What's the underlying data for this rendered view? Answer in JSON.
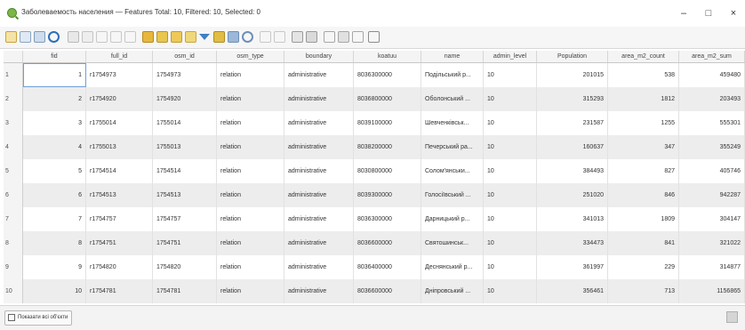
{
  "window": {
    "title": "Заболеваемость населения — Features Total: 10, Filtered: 10, Selected: 0",
    "minimize_glyph": "–",
    "maximize_glyph": "□",
    "close_glyph": "×"
  },
  "toolbar": {
    "icons": [
      "toggle-editing-icon",
      "multi-edit-icon",
      "save-edits-icon",
      "reload-icon",
      "add-feature-icon",
      "delete-feature-icon",
      "cut-icon",
      "copy-icon",
      "paste-icon",
      "select-by-expression-icon",
      "select-all-icon",
      "invert-selection-icon",
      "deselect-all-icon",
      "filter-icon",
      "move-selection-top-icon",
      "pan-to-selected-icon",
      "zoom-to-selected-icon",
      "new-field-icon",
      "delete-field-icon",
      "field-calculator-icon",
      "conditional-formatting-icon",
      "actions-icon",
      "dock-icon"
    ]
  },
  "table": {
    "columns": [
      "fid",
      "full_id",
      "osm_id",
      "osm_type",
      "boundary",
      "koatuu",
      "name",
      "admin_level",
      "Population",
      "area_m2_count",
      "area_m2_sum"
    ],
    "rows": [
      {
        "num": "1",
        "fid": "1",
        "full_id": "r1754973",
        "osm_id": "1754973",
        "osm_type": "relation",
        "boundary": "administrative",
        "koatuu": "8036300000",
        "name": "Подільський р...",
        "admin_level": "10",
        "Population": "201015",
        "area_count": "538",
        "area_sum": "459480"
      },
      {
        "num": "2",
        "fid": "2",
        "full_id": "r1754920",
        "osm_id": "1754920",
        "osm_type": "relation",
        "boundary": "administrative",
        "koatuu": "8036800000",
        "name": "Оболонський ...",
        "admin_level": "10",
        "Population": "315293",
        "area_count": "1812",
        "area_sum": "203493"
      },
      {
        "num": "3",
        "fid": "3",
        "full_id": "r1755014",
        "osm_id": "1755014",
        "osm_type": "relation",
        "boundary": "administrative",
        "koatuu": "8039100000",
        "name": "Шевченківськ...",
        "admin_level": "10",
        "Population": "231587",
        "area_count": "1255",
        "area_sum": "555301"
      },
      {
        "num": "4",
        "fid": "4",
        "full_id": "r1755013",
        "osm_id": "1755013",
        "osm_type": "relation",
        "boundary": "administrative",
        "koatuu": "8038200000",
        "name": "Печерський ра...",
        "admin_level": "10",
        "Population": "160637",
        "area_count": "347",
        "area_sum": "355249"
      },
      {
        "num": "5",
        "fid": "5",
        "full_id": "r1754514",
        "osm_id": "1754514",
        "osm_type": "relation",
        "boundary": "administrative",
        "koatuu": "8030800000",
        "name": "Солом'янськи...",
        "admin_level": "10",
        "Population": "384493",
        "area_count": "827",
        "area_sum": "405746"
      },
      {
        "num": "6",
        "fid": "6",
        "full_id": "r1754513",
        "osm_id": "1754513",
        "osm_type": "relation",
        "boundary": "administrative",
        "koatuu": "8039300000",
        "name": "Голосіївський ...",
        "admin_level": "10",
        "Population": "251020",
        "area_count": "846",
        "area_sum": "942287"
      },
      {
        "num": "7",
        "fid": "7",
        "full_id": "r1754757",
        "osm_id": "1754757",
        "osm_type": "relation",
        "boundary": "administrative",
        "koatuu": "8036300000",
        "name": "Дарницький р...",
        "admin_level": "10",
        "Population": "341013",
        "area_count": "1809",
        "area_sum": "304147"
      },
      {
        "num": "8",
        "fid": "8",
        "full_id": "r1754751",
        "osm_id": "1754751",
        "osm_type": "relation",
        "boundary": "administrative",
        "koatuu": "8036600000",
        "name": "Святошинськ...",
        "admin_level": "10",
        "Population": "334473",
        "area_count": "841",
        "area_sum": "321022"
      },
      {
        "num": "9",
        "fid": "9",
        "full_id": "r1754820",
        "osm_id": "1754820",
        "osm_type": "relation",
        "boundary": "administrative",
        "koatuu": "8036400000",
        "name": "Деснянський р...",
        "admin_level": "10",
        "Population": "361997",
        "area_count": "229",
        "area_sum": "314877"
      },
      {
        "num": "10",
        "fid": "10",
        "full_id": "r1754781",
        "osm_id": "1754781",
        "osm_type": "relation",
        "boundary": "administrative",
        "koatuu": "8036600000",
        "name": "Дніпровський ...",
        "admin_level": "10",
        "Population": "356461",
        "area_count": "713",
        "area_sum": "1156865"
      }
    ]
  },
  "status": {
    "show_all_label": "Показати всі об'єкти"
  }
}
